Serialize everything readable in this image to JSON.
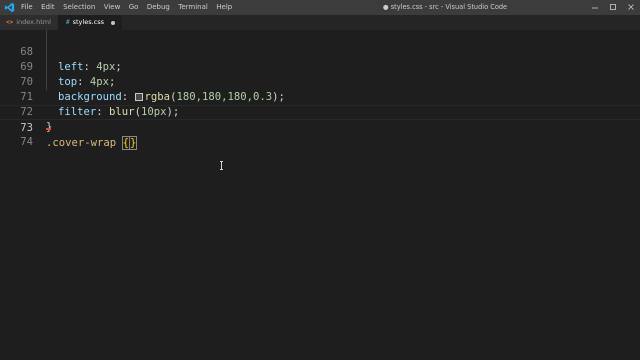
{
  "titlebar": {
    "menu": [
      "File",
      "Edit",
      "Selection",
      "View",
      "Go",
      "Debug",
      "Terminal",
      "Help"
    ],
    "window_title": "● styles.css - src - Visual Studio Code"
  },
  "tabs": [
    {
      "icon": "<>",
      "label": "index.html",
      "active": false
    },
    {
      "icon": "#",
      "label": "styles.css",
      "active": true,
      "unsaved": true
    }
  ],
  "editor": {
    "lines": [
      {
        "num": "68",
        "prop": "left",
        "value": "4px"
      },
      {
        "num": "69",
        "prop": "top",
        "value": "4px"
      },
      {
        "num": "70",
        "prop": "background",
        "fn": "rgba",
        "args": "180,180,180,0.3",
        "swatch_color": "#b4b4b4"
      },
      {
        "num": "71",
        "prop": "filter",
        "fn": "blur",
        "args": "10px"
      },
      {
        "num": "72",
        "text": "}"
      },
      {
        "num": "73",
        "selector": ".cover-wrap",
        "open": "{",
        "close": "}"
      },
      {
        "num": "74",
        "text": ""
      }
    ]
  },
  "colors": {
    "accent": "#007acc",
    "property": "#9cdcfe",
    "number": "#b5cea8",
    "function": "#dcdcaa",
    "selector": "#d7ba7d"
  }
}
